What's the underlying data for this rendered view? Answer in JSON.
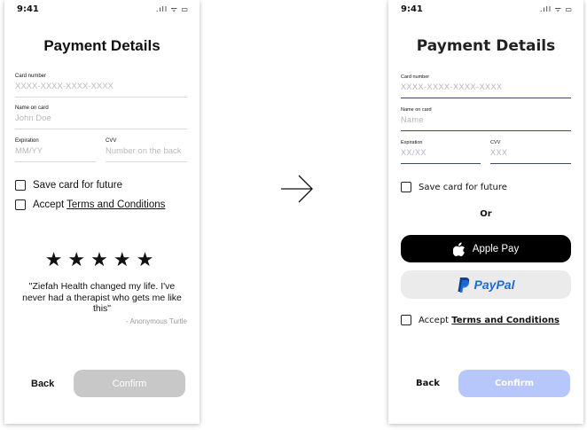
{
  "status_bar": {
    "time": "9:41",
    "icons_text": ".ıll ᯤ ▭"
  },
  "left_screen": {
    "title": "Payment Details",
    "card_number": {
      "label": "Card number",
      "placeholder": "XXXX-XXXX-XXXX-XXXX"
    },
    "name_on_card": {
      "label": "Name on card",
      "placeholder": "John Doe"
    },
    "expiration": {
      "label": "Expiration",
      "placeholder": "MM/YY"
    },
    "cvv": {
      "label": "CVV",
      "placeholder": "Number on the back"
    },
    "save_card": "Save card for future",
    "accept_prefix": "Accept ",
    "accept_link": "Terms and Conditions",
    "stars": "★★★★★",
    "quote": "\"Ziefah Health changed my life. I've never had a therapist who gets me like this\"",
    "quote_author": "- Anonymous Turtle",
    "back": "Back",
    "confirm": "Confirm"
  },
  "right_screen": {
    "title": "Payment Details",
    "card_number": {
      "label": "Card number",
      "placeholder": "XXXX-XXXX-XXXX-XXXX"
    },
    "name_on_card": {
      "label": "Name on card",
      "placeholder": "Name"
    },
    "expiration": {
      "label": "Expiration",
      "placeholder": "XX/XX"
    },
    "cvv": {
      "label": "CVV",
      "placeholder": "XXX"
    },
    "save_card": "Save card for future",
    "or_text": "Or",
    "apple_pay": "Apple Pay",
    "paypal": "PayPal",
    "accept_prefix": "Accept ",
    "accept_link": "Terms and Conditions",
    "back": "Back",
    "confirm": "Confirm"
  },
  "colors": {
    "left_confirm_bg": "#c8c8c8",
    "right_confirm_bg": "#b7c6fb",
    "paypal_blue": "#1d6bd6",
    "paypal_dark": "#0f3f8f"
  },
  "icons": {
    "arrow": "right-arrow-icon",
    "apple": "apple-logo-icon",
    "paypal": "paypal-logo-icon"
  }
}
